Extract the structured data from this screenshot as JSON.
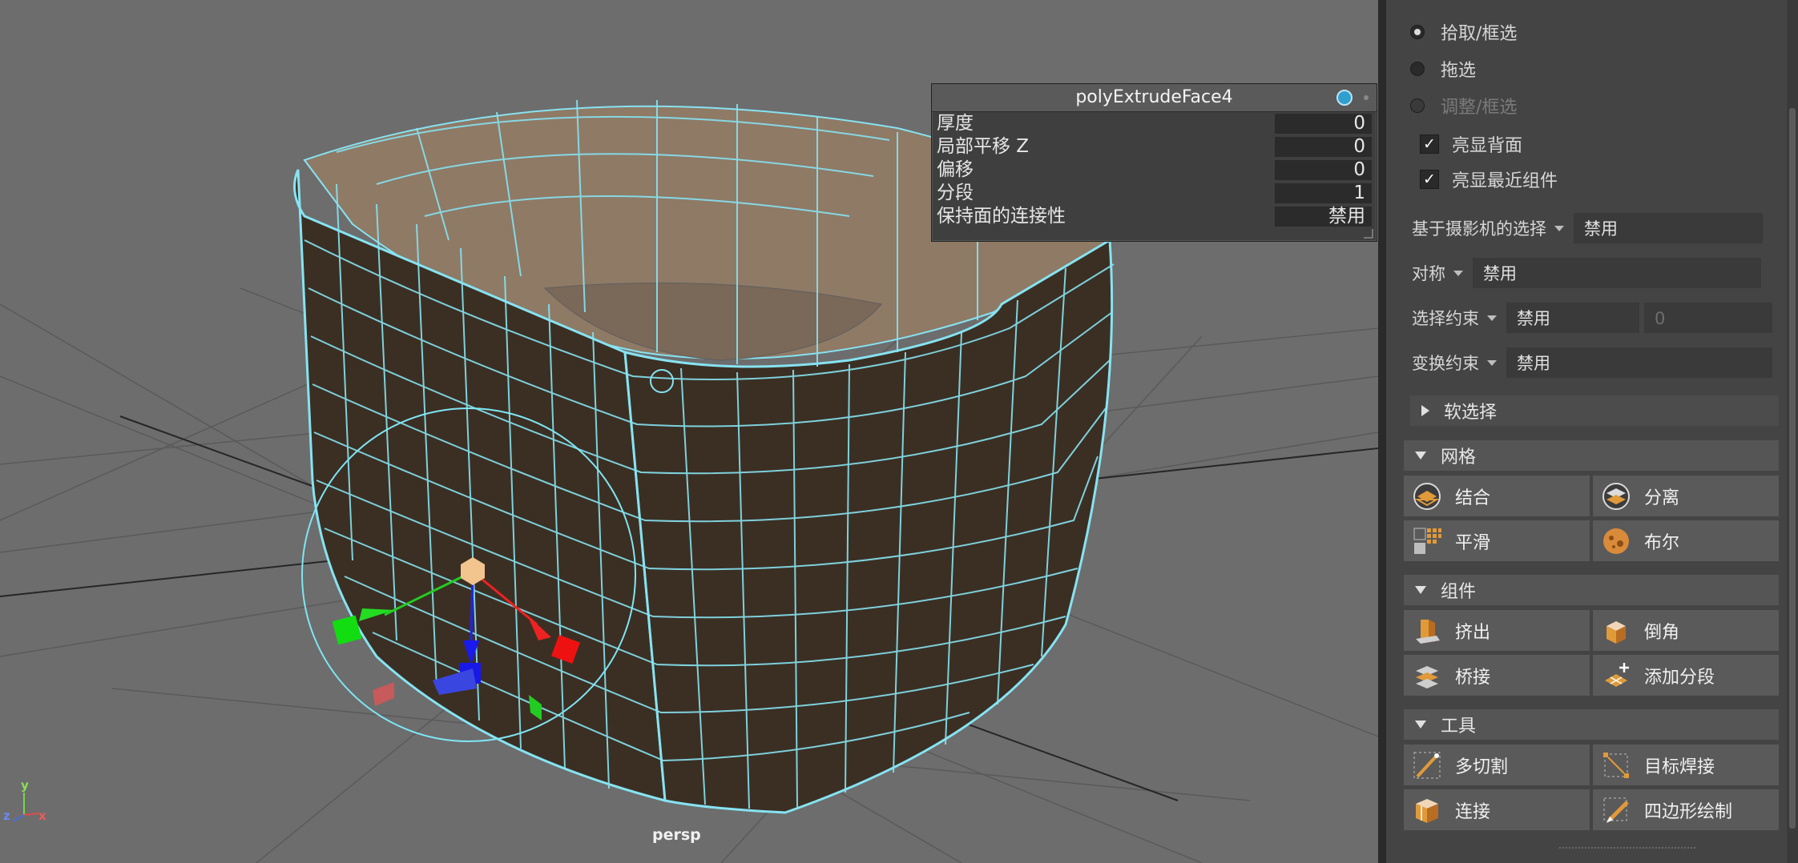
{
  "viewport": {
    "camera": "persp",
    "axes": {
      "x": "x",
      "y": "y",
      "z": "z"
    }
  },
  "node_editor": {
    "title": "polyExtrudeFace4",
    "attributes": [
      {
        "label": "厚度",
        "value": "0"
      },
      {
        "label": "局部平移 Z",
        "value": "0"
      },
      {
        "label": "偏移",
        "value": "0"
      },
      {
        "label": "分段",
        "value": "1"
      },
      {
        "label": "保持面的连接性",
        "value": "禁用"
      }
    ]
  },
  "selection": {
    "modes": [
      {
        "label": "拾取/框选",
        "selected": true
      },
      {
        "label": "拖选",
        "selected": false
      },
      {
        "label": "调整/框选",
        "selected": false,
        "disabled": true
      }
    ],
    "checkboxes": [
      {
        "label": "亮显背面",
        "checked": true
      },
      {
        "label": "亮显最近组件",
        "checked": true
      }
    ],
    "camera_based": {
      "label": "基于摄影机的选择",
      "value": "禁用"
    },
    "symmetry": {
      "label": "对称",
      "value": "禁用"
    },
    "constraint": {
      "label": "选择约束",
      "value": "禁用",
      "amount": "0"
    },
    "transform_constraint": {
      "label": "变换约束",
      "value": "禁用"
    },
    "soft_select": {
      "label": "软选择"
    }
  },
  "sections": {
    "mesh": {
      "title": "网格",
      "buttons": [
        {
          "label": "结合",
          "icon": "combine-icon"
        },
        {
          "label": "分离",
          "icon": "separate-icon"
        },
        {
          "label": "平滑",
          "icon": "smooth-icon"
        },
        {
          "label": "布尔",
          "icon": "boolean-icon"
        }
      ]
    },
    "components": {
      "title": "组件",
      "buttons": [
        {
          "label": "挤出",
          "icon": "extrude-icon"
        },
        {
          "label": "倒角",
          "icon": "bevel-icon"
        },
        {
          "label": "桥接",
          "icon": "bridge-icon"
        },
        {
          "label": "添加分段",
          "icon": "add-divisions-icon"
        }
      ]
    },
    "tools": {
      "title": "工具",
      "buttons": [
        {
          "label": "多切割",
          "icon": "multi-cut-icon"
        },
        {
          "label": "目标焊接",
          "icon": "target-weld-icon"
        },
        {
          "label": "连接",
          "icon": "connect-icon"
        },
        {
          "label": "四边形绘制",
          "icon": "quad-draw-icon"
        }
      ]
    }
  },
  "colors": {
    "wire": "#86e3f2",
    "face": "#3b2f23",
    "face_inner": "#8f7a66",
    "grid": "#5a5a5a",
    "accent_orange": "#d98b3a"
  }
}
